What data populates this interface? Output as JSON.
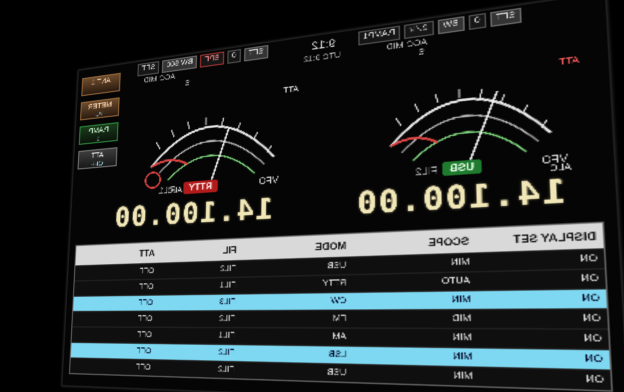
{
  "panel": {
    "left": {
      "vfo_label": "VFO",
      "mode_label": "USB",
      "fil_label": "FIL2",
      "frequency": "14.100.00",
      "agc_label": "AGC-MID",
      "meter_label_top": "S",
      "meter_label_bottom": "ALC",
      "meter_label_left": "ATT",
      "strip": [
        "SFT",
        "0",
        "BW",
        "2.4k",
        "P.AMP1"
      ]
    },
    "right": {
      "vfo_label": "VFO",
      "mode_label": "RTTY",
      "fil_label": "FIL1",
      "frequency": "14.100.00",
      "agc_label": "AGC-MID",
      "meter_label_top": "S",
      "meter_label_bottom": "ALC",
      "meter_label_left": "ATT",
      "strip": [
        "SFT",
        "0",
        "BPF",
        "BW 500",
        "SFT"
      ]
    },
    "top_text": {
      "time": "9:12",
      "utc": "UTC 9:12"
    }
  },
  "right_buttons": [
    {
      "label": "ANT 1",
      "sub": ""
    },
    {
      "label": "METER",
      "sub": "Po"
    },
    {
      "label": "P.AMP",
      "sub": "1"
    },
    {
      "label": "ATT",
      "sub": "OFF"
    }
  ],
  "table": {
    "headers": [
      "DISPLAY SET",
      "SCOPE",
      "MODE",
      "FIL",
      "ATT"
    ],
    "rows": [
      [
        "ON",
        "MIN",
        "USB",
        "FIL2",
        "OFF"
      ],
      [
        "ON",
        "AUTO",
        "RTTY",
        "FIL1",
        "OFF"
      ],
      [
        "ON",
        "MIN",
        "CW",
        "FIL3",
        "OFF"
      ],
      [
        "ON",
        "MID",
        "FM",
        "FIL2",
        "OFF"
      ],
      [
        "ON",
        "MIN",
        "AM",
        "FIL1",
        "OFF"
      ],
      [
        "ON",
        "MIN",
        "LSB",
        "FIL2",
        "OFF"
      ],
      [
        "ON",
        "MIN",
        "USB",
        "FIL2",
        "OFF"
      ]
    ],
    "highlighted_rows": [
      2,
      5
    ]
  },
  "colors": {
    "background": "#000000",
    "freq": "#f0e6b6",
    "usb": "#1f7b2e",
    "rtty": "#b31b1b",
    "highlight": "#7fd8f2"
  }
}
